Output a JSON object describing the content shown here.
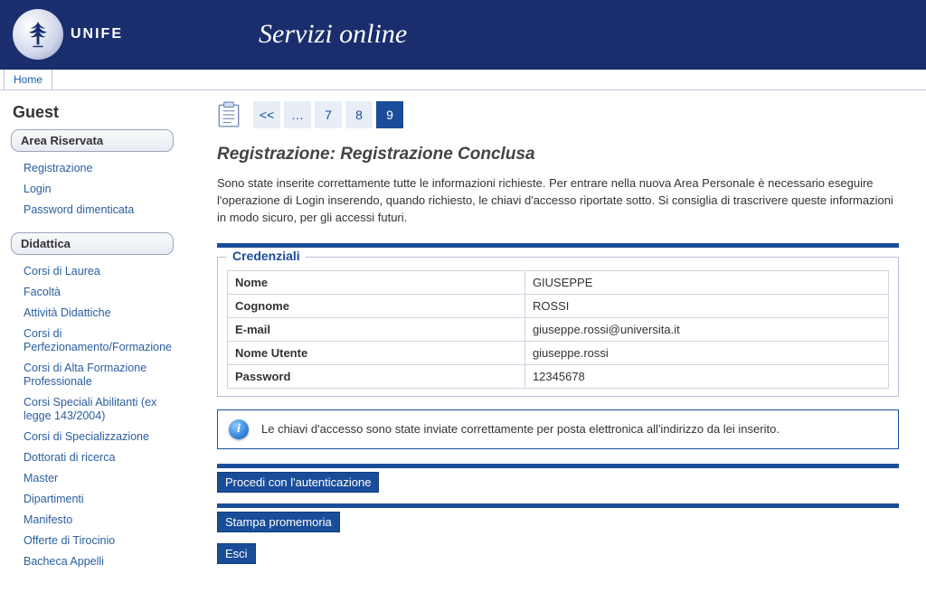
{
  "brand": {
    "name": "UNIFE",
    "service_title": "Servizi online"
  },
  "breadcrumb": {
    "home": "Home"
  },
  "sidebar": {
    "guest": "Guest",
    "area_riservata": {
      "header": "Area Riservata",
      "items": [
        "Registrazione",
        "Login",
        "Password dimenticata"
      ]
    },
    "didattica": {
      "header": "Didattica",
      "items": [
        "Corsi di Laurea",
        "Facoltà",
        "Attività Didattiche",
        "Corsi di Perfezionamento/Formazione",
        "Corsi di Alta Formazione Professionale",
        "Corsi Speciali Abilitanti (ex legge 143/2004)",
        "Corsi di Specializzazione",
        "Dottorati di ricerca",
        "Master",
        "Dipartimenti",
        "Manifesto",
        "Offerte di Tirocinio",
        "Bacheca Appelli"
      ]
    }
  },
  "wizard": {
    "steps": [
      "<<",
      "…",
      "7",
      "8",
      "9"
    ],
    "current_index": 4
  },
  "page": {
    "title": "Registrazione: Registrazione Conclusa",
    "intro": "Sono state inserite correttamente tutte le informazioni richieste. Per entrare nella nuova Area Personale è necessario eseguire l'operazione di Login inserendo, quando richiesto, le chiavi d'accesso riportate sotto. Si consiglia di trascrivere queste informazioni in modo sicuro, per gli accessi futuri."
  },
  "credenziali": {
    "legend": "Credenziali",
    "rows": [
      {
        "k": "Nome",
        "v": "GIUSEPPE"
      },
      {
        "k": "Cognome",
        "v": "ROSSI"
      },
      {
        "k": "E-mail",
        "v": "giuseppe.rossi@universita.it"
      },
      {
        "k": "Nome Utente",
        "v": "giuseppe.rossi"
      },
      {
        "k": "Password",
        "v": "12345678"
      }
    ]
  },
  "info_msg": "Le chiavi d'accesso sono state inviate correttamente per posta elettronica all'indirizzo da lei inserito.",
  "buttons": {
    "proceed": "Procedi con l'autenticazione",
    "print": "Stampa promemoria",
    "exit": "Esci"
  }
}
